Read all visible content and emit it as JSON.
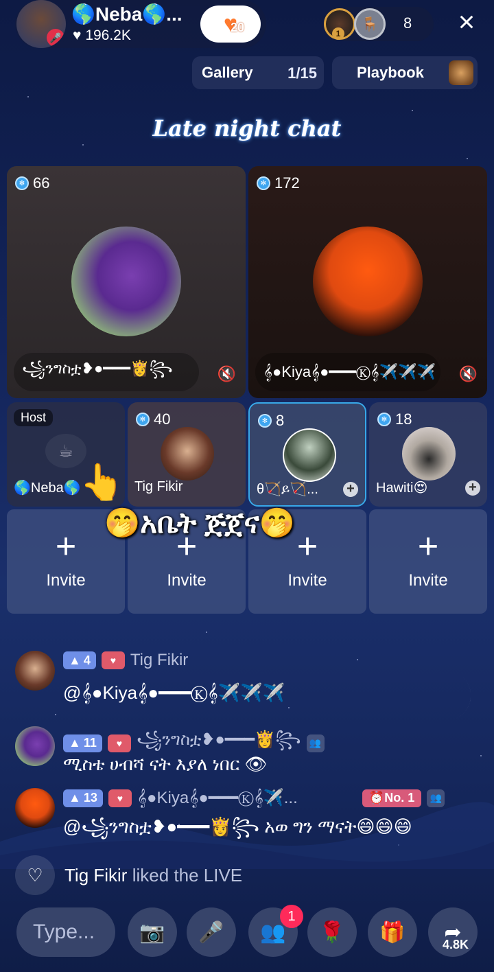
{
  "header": {
    "host_name": "🌎Neba🌎...",
    "likes": "196.2K",
    "follow_badge_count": "20",
    "viewer_badge": "1",
    "viewer_count": "8",
    "close_icon": "close-icon"
  },
  "toolbar": {
    "gallery_label": "Gallery",
    "gallery_count": "1/15",
    "playbook_label": "Playbook"
  },
  "room": {
    "title": "Late night chat"
  },
  "seats_big": [
    {
      "count": "66",
      "name": "꧁ንግስቷ❥●━━━👸꧂",
      "muted": true
    },
    {
      "count": "172",
      "name": "𝄞●Kiya𝄞●━━━Ⓚ𝄞✈️✈️✈️",
      "muted": true
    }
  ],
  "seats_small": [
    {
      "label": "Host",
      "name": "🌎Neba🌎"
    },
    {
      "count": "40",
      "name": "Tig Fikir"
    },
    {
      "count": "8",
      "name": "θ🏹ይ🏹..."
    },
    {
      "count": "18",
      "name": "Hawiti😍"
    }
  ],
  "invite_label": "Invite",
  "overlay_text": "🤭አቤት ጅጀና🤭",
  "chat": [
    {
      "level": "4",
      "user": "Tig Fikir",
      "text": "@𝄞●Kiya𝄞●━━━Ⓚ𝄞✈️✈️✈️"
    },
    {
      "level": "11",
      "user": "꧁ንግስቷ❥●━━━👸꧂",
      "text": "ሚስቴ ሀብሻ ናት እያለ ነበር 👁"
    },
    {
      "level": "13",
      "user": "𝄞●Kiya𝄞●━━━Ⓚ𝄞✈️...",
      "rank": "No. 1",
      "text": "@꧁ንግስቷ❥●━━━👸꧂ አወ ግን ማናት😄😄😄"
    }
  ],
  "like_event": {
    "user": "Tig Fikir",
    "text": " liked the LIVE"
  },
  "bottom": {
    "type_placeholder": "Type...",
    "users_notif": "1",
    "share_count": "4.8K"
  },
  "colors": {
    "accent": "#3fa6f0",
    "background": "#13245a",
    "notification": "#ff2a5a"
  }
}
